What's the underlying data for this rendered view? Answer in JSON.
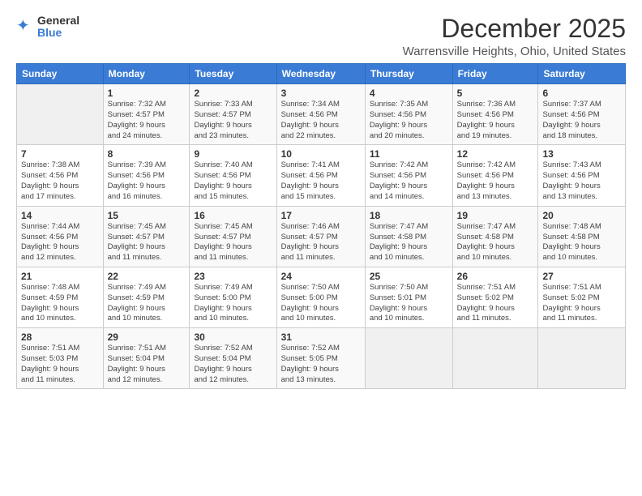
{
  "logo": {
    "general": "General",
    "blue": "Blue"
  },
  "title": "December 2025",
  "subtitle": "Warrensville Heights, Ohio, United States",
  "days_of_week": [
    "Sunday",
    "Monday",
    "Tuesday",
    "Wednesday",
    "Thursday",
    "Friday",
    "Saturday"
  ],
  "weeks": [
    [
      {
        "day": "",
        "info": ""
      },
      {
        "day": "1",
        "info": "Sunrise: 7:32 AM\nSunset: 4:57 PM\nDaylight: 9 hours\nand 24 minutes."
      },
      {
        "day": "2",
        "info": "Sunrise: 7:33 AM\nSunset: 4:57 PM\nDaylight: 9 hours\nand 23 minutes."
      },
      {
        "day": "3",
        "info": "Sunrise: 7:34 AM\nSunset: 4:56 PM\nDaylight: 9 hours\nand 22 minutes."
      },
      {
        "day": "4",
        "info": "Sunrise: 7:35 AM\nSunset: 4:56 PM\nDaylight: 9 hours\nand 20 minutes."
      },
      {
        "day": "5",
        "info": "Sunrise: 7:36 AM\nSunset: 4:56 PM\nDaylight: 9 hours\nand 19 minutes."
      },
      {
        "day": "6",
        "info": "Sunrise: 7:37 AM\nSunset: 4:56 PM\nDaylight: 9 hours\nand 18 minutes."
      }
    ],
    [
      {
        "day": "7",
        "info": "Sunrise: 7:38 AM\nSunset: 4:56 PM\nDaylight: 9 hours\nand 17 minutes."
      },
      {
        "day": "8",
        "info": "Sunrise: 7:39 AM\nSunset: 4:56 PM\nDaylight: 9 hours\nand 16 minutes."
      },
      {
        "day": "9",
        "info": "Sunrise: 7:40 AM\nSunset: 4:56 PM\nDaylight: 9 hours\nand 15 minutes."
      },
      {
        "day": "10",
        "info": "Sunrise: 7:41 AM\nSunset: 4:56 PM\nDaylight: 9 hours\nand 15 minutes."
      },
      {
        "day": "11",
        "info": "Sunrise: 7:42 AM\nSunset: 4:56 PM\nDaylight: 9 hours\nand 14 minutes."
      },
      {
        "day": "12",
        "info": "Sunrise: 7:42 AM\nSunset: 4:56 PM\nDaylight: 9 hours\nand 13 minutes."
      },
      {
        "day": "13",
        "info": "Sunrise: 7:43 AM\nSunset: 4:56 PM\nDaylight: 9 hours\nand 13 minutes."
      }
    ],
    [
      {
        "day": "14",
        "info": "Sunrise: 7:44 AM\nSunset: 4:56 PM\nDaylight: 9 hours\nand 12 minutes."
      },
      {
        "day": "15",
        "info": "Sunrise: 7:45 AM\nSunset: 4:57 PM\nDaylight: 9 hours\nand 11 minutes."
      },
      {
        "day": "16",
        "info": "Sunrise: 7:45 AM\nSunset: 4:57 PM\nDaylight: 9 hours\nand 11 minutes."
      },
      {
        "day": "17",
        "info": "Sunrise: 7:46 AM\nSunset: 4:57 PM\nDaylight: 9 hours\nand 11 minutes."
      },
      {
        "day": "18",
        "info": "Sunrise: 7:47 AM\nSunset: 4:58 PM\nDaylight: 9 hours\nand 10 minutes."
      },
      {
        "day": "19",
        "info": "Sunrise: 7:47 AM\nSunset: 4:58 PM\nDaylight: 9 hours\nand 10 minutes."
      },
      {
        "day": "20",
        "info": "Sunrise: 7:48 AM\nSunset: 4:58 PM\nDaylight: 9 hours\nand 10 minutes."
      }
    ],
    [
      {
        "day": "21",
        "info": "Sunrise: 7:48 AM\nSunset: 4:59 PM\nDaylight: 9 hours\nand 10 minutes."
      },
      {
        "day": "22",
        "info": "Sunrise: 7:49 AM\nSunset: 4:59 PM\nDaylight: 9 hours\nand 10 minutes."
      },
      {
        "day": "23",
        "info": "Sunrise: 7:49 AM\nSunset: 5:00 PM\nDaylight: 9 hours\nand 10 minutes."
      },
      {
        "day": "24",
        "info": "Sunrise: 7:50 AM\nSunset: 5:00 PM\nDaylight: 9 hours\nand 10 minutes."
      },
      {
        "day": "25",
        "info": "Sunrise: 7:50 AM\nSunset: 5:01 PM\nDaylight: 9 hours\nand 10 minutes."
      },
      {
        "day": "26",
        "info": "Sunrise: 7:51 AM\nSunset: 5:02 PM\nDaylight: 9 hours\nand 11 minutes."
      },
      {
        "day": "27",
        "info": "Sunrise: 7:51 AM\nSunset: 5:02 PM\nDaylight: 9 hours\nand 11 minutes."
      }
    ],
    [
      {
        "day": "28",
        "info": "Sunrise: 7:51 AM\nSunset: 5:03 PM\nDaylight: 9 hours\nand 11 minutes."
      },
      {
        "day": "29",
        "info": "Sunrise: 7:51 AM\nSunset: 5:04 PM\nDaylight: 9 hours\nand 12 minutes."
      },
      {
        "day": "30",
        "info": "Sunrise: 7:52 AM\nSunset: 5:04 PM\nDaylight: 9 hours\nand 12 minutes."
      },
      {
        "day": "31",
        "info": "Sunrise: 7:52 AM\nSunset: 5:05 PM\nDaylight: 9 hours\nand 13 minutes."
      },
      {
        "day": "",
        "info": ""
      },
      {
        "day": "",
        "info": ""
      },
      {
        "day": "",
        "info": ""
      }
    ]
  ]
}
